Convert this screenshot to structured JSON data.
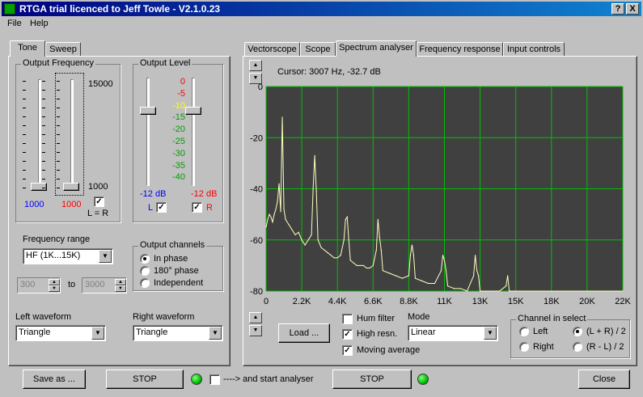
{
  "window": {
    "title": "RTGA trial licenced to Jeff Towle - V2.1.0.23",
    "help_btn": "?",
    "close_btn": "X"
  },
  "menu": {
    "file": "File",
    "help": "Help"
  },
  "left_tabs": {
    "tone": "Tone",
    "sweep": "Sweep"
  },
  "output_frequency": {
    "label": "Output Frequency",
    "max_label": "15000",
    "min_label": "1000",
    "left_value": "1000",
    "right_value": "1000",
    "lr_label": "L = R",
    "lr_checked": true,
    "left_color": "#0000ff",
    "right_color": "#ff0000"
  },
  "output_level": {
    "label": "Output Level",
    "scale": [
      "0",
      "-5",
      "-10",
      "-15",
      "-20",
      "-25",
      "-30",
      "-35",
      "-40"
    ],
    "left_db": "-12 dB",
    "right_db": "-12 dB",
    "left_label": "L",
    "right_label": "R"
  },
  "frequency_range": {
    "label": "Frequency range",
    "value": "HF (1K...15K)",
    "from": "300",
    "to_label": "to",
    "to": "3000"
  },
  "output_channels": {
    "label": "Output channels",
    "options": [
      "In phase",
      "180° phase",
      "Independent"
    ],
    "selected": 0
  },
  "left_waveform": {
    "label": "Left waveform",
    "value": "Triangle"
  },
  "right_waveform": {
    "label": "Right waveform",
    "value": "Triangle"
  },
  "right_tabs": [
    "Vectorscope",
    "Scope",
    "Spectrum analyser",
    "Frequency response",
    "Input controls"
  ],
  "cursor_readout": "Cursor: 3007 Hz,  -32.7 dB",
  "plot_colors": {
    "background": "#404040",
    "grid": "#00c000",
    "trace": "#ffffc0"
  },
  "controls": {
    "load": "Load ...",
    "hum_filter": "Hum filter",
    "hum_checked": false,
    "high_resn": "High resn.",
    "high_checked": true,
    "moving_avg": "Moving average",
    "moving_checked": true,
    "mode_label": "Mode",
    "mode_value": "Linear"
  },
  "channel_select": {
    "label": "Channel in select",
    "options": [
      "Left",
      "(L + R) / 2",
      "Right",
      "(R - L) / 2"
    ],
    "selected": 1
  },
  "bottom": {
    "save_as": "Save as ...",
    "stop1": "STOP",
    "start_label": "----> and start analyser",
    "stop2": "STOP",
    "close": "Close"
  },
  "chart_data": {
    "type": "line",
    "title": "",
    "xlabel": "",
    "ylabel": "",
    "xlim": [
      0,
      22000
    ],
    "ylim": [
      -80,
      0
    ],
    "x_ticks": [
      "0",
      "2.2K",
      "4.4K",
      "6.6K",
      "8.8K",
      "11K",
      "13K",
      "15K",
      "18K",
      "20K",
      "22K"
    ],
    "y_ticks": [
      "0",
      "-20",
      "-40",
      "-60",
      "-80"
    ],
    "grid": true,
    "series": [
      {
        "x": [
          0,
          100,
          200,
          300,
          400,
          500,
          600,
          700,
          800,
          900,
          1000,
          1100,
          1200,
          1400,
          1600,
          1800,
          2000,
          2200,
          2400,
          2600,
          2800,
          2900,
          3000,
          3100,
          3200,
          3400,
          3600,
          3800,
          4000,
          4200,
          4400,
          4600,
          4800,
          4900,
          5000,
          5100,
          5200,
          5400,
          5600,
          5800,
          6000,
          6200,
          6400,
          6600,
          6800,
          6900,
          7000,
          7100,
          7200,
          7600,
          8000,
          8400,
          8800,
          8900,
          9000,
          9100,
          9200,
          9600,
          10000,
          10400,
          10800,
          10900,
          11000,
          11100,
          11200,
          11600,
          12000,
          12400,
          12800,
          12900,
          13000,
          13100,
          13200,
          13600,
          14000,
          14400,
          14800,
          14900,
          15000,
          15100,
          15200,
          16000,
          18000,
          20000,
          22000
        ],
        "y": [
          -55,
          -52,
          -50,
          -51,
          -53,
          -50,
          -48,
          -45,
          -38,
          -49,
          -12,
          -48,
          -52,
          -54,
          -56,
          -58,
          -57,
          -60,
          -62,
          -60,
          -58,
          -40,
          -27,
          -41,
          -60,
          -63,
          -64,
          -65,
          -66,
          -67,
          -67,
          -66,
          -60,
          -52,
          -51,
          -60,
          -68,
          -69,
          -70,
          -70,
          -70,
          -71,
          -71,
          -70,
          -64,
          -52,
          -59,
          -64,
          -72,
          -73,
          -74,
          -75,
          -74,
          -66,
          -62,
          -66,
          -75,
          -76,
          -77,
          -77,
          -72,
          -66,
          -68,
          -72,
          -78,
          -79,
          -79,
          -80,
          -74,
          -66,
          -72,
          -74,
          -80,
          -80,
          -80,
          -80,
          -78,
          -74,
          -80,
          -80,
          -80,
          -80,
          -80,
          -80,
          -80
        ]
      }
    ]
  }
}
